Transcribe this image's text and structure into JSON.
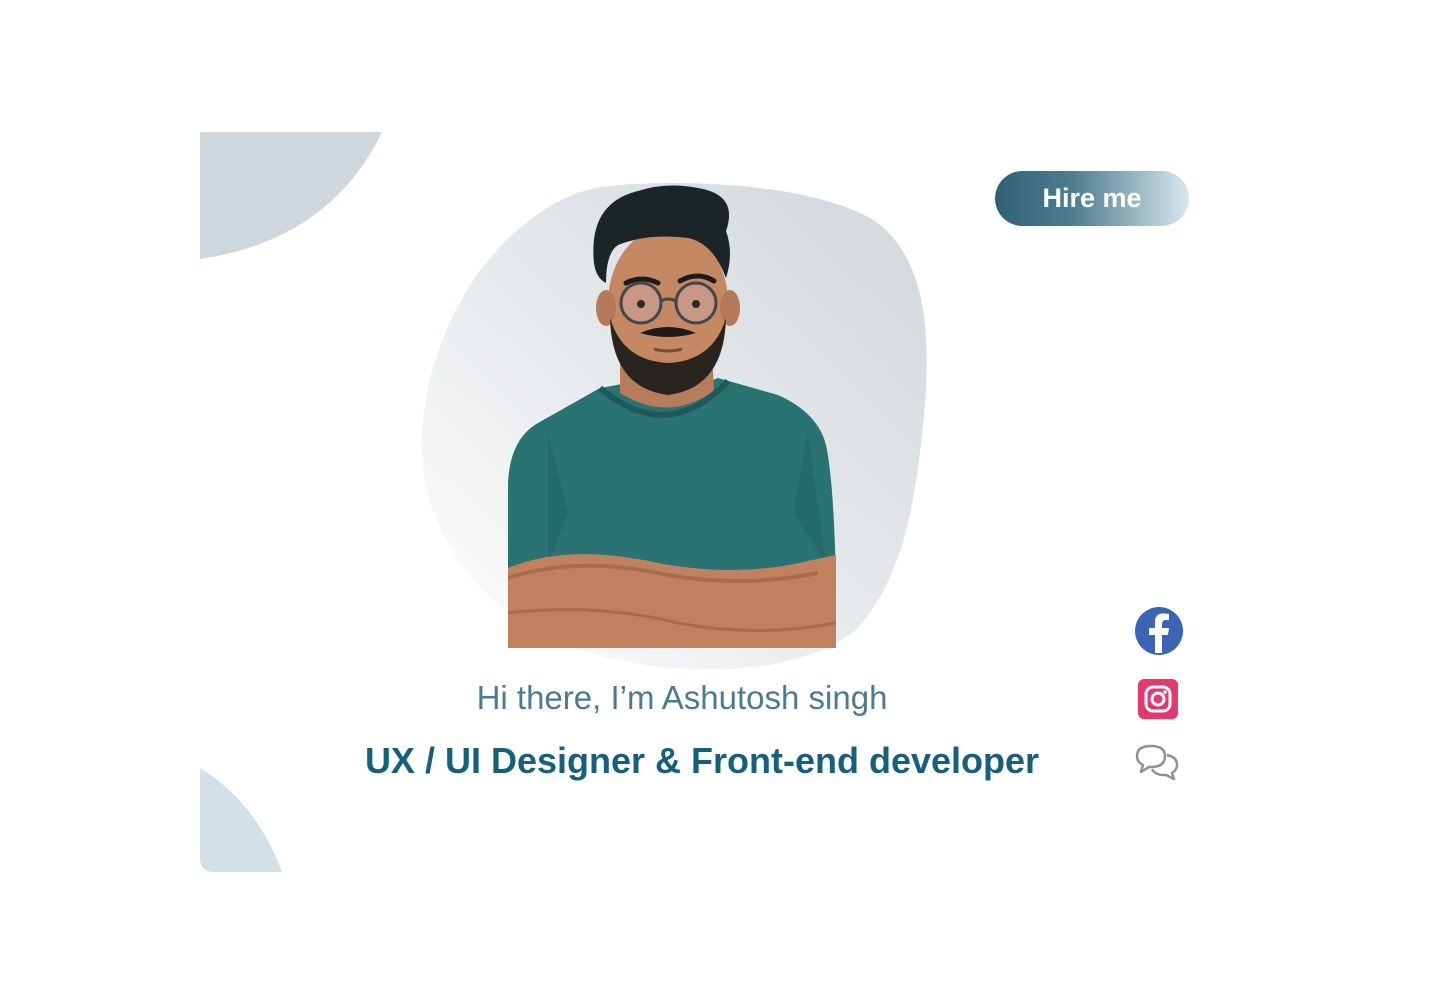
{
  "header": {
    "hire_label": "Hire me"
  },
  "hero": {
    "greeting": "Hi there, I’m Ashutosh singh",
    "role": "UX / UI Designer & Front-end developer"
  },
  "social": {
    "facebook_icon": "facebook-icon",
    "instagram_icon": "instagram-icon",
    "chat_icon": "chat-bubbles-icon"
  },
  "colors": {
    "primary": "#16607e",
    "greeting": "#4d7a93",
    "hire_gradient_start": "#2f6176",
    "hire_gradient_end": "#d7e8ee",
    "shape_gray": "#ced7dc",
    "shape_blue": "#d2e1e8",
    "blob": "#d6dadd",
    "facebook": "#3b64b5",
    "instagram": "#e6376f",
    "chat_icon": "#8d9297"
  }
}
